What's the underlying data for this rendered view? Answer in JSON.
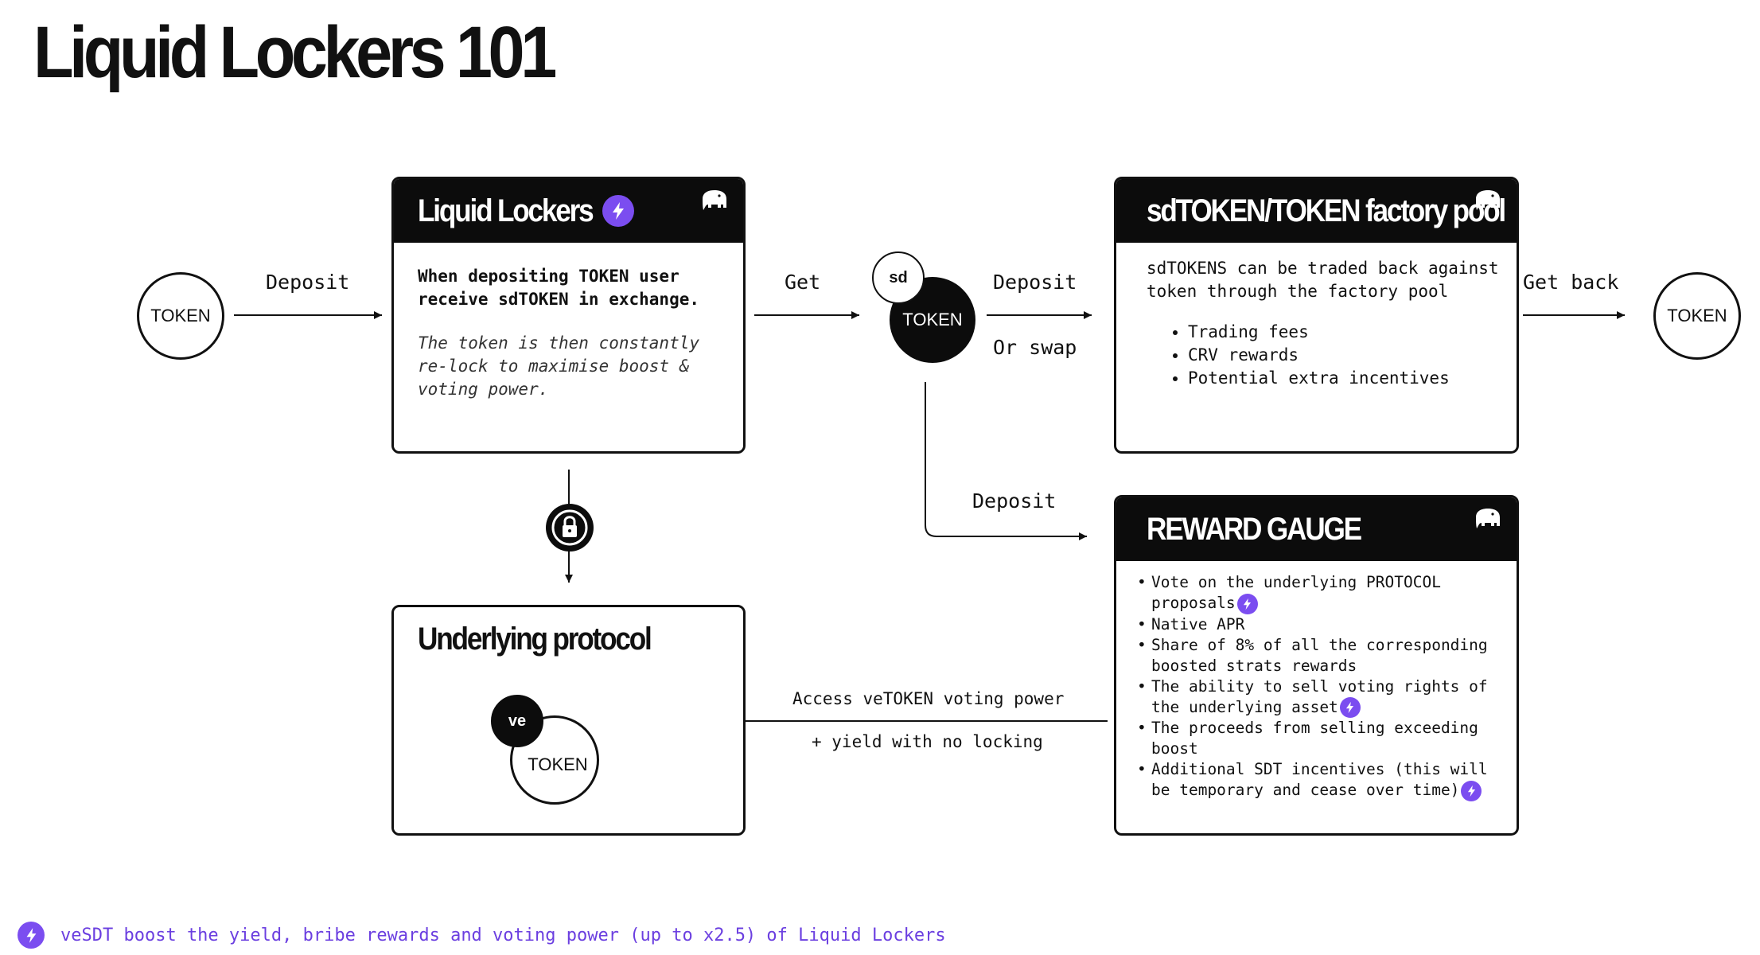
{
  "title": "Liquid Lockers 101",
  "colors": {
    "accent": "#7b4df0",
    "dark": "#0c0c0c",
    "line": "#111111"
  },
  "token_left": "TOKEN",
  "token_right": "TOKEN",
  "sdtoken": {
    "badge": "sd",
    "label": "TOKEN"
  },
  "vetoken": {
    "badge": "ve",
    "label": "TOKEN"
  },
  "edges": {
    "deposit_1": "Deposit",
    "get": "Get",
    "deposit_2": "Deposit",
    "or_swap": "Or swap",
    "get_back": "Get back",
    "deposit_3": "Deposit",
    "access_line1": "Access veTOKEN voting power",
    "access_line2": "+ yield with no locking"
  },
  "cards": {
    "liquid_lockers": {
      "title": "Liquid Lockers",
      "text": "When depositing TOKEN user\nreceive sdTOKEN in exchange.",
      "italic": "The token is then constantly\nre-lock to maximise boost &\nvoting power."
    },
    "factory_pool": {
      "title": "sdTOKEN/TOKEN factory pool",
      "text": "sdTOKENS can be traded back against\ntoken through the factory pool",
      "bullets": [
        "Trading fees",
        "CRV rewards",
        "Potential extra incentives"
      ]
    },
    "underlying": {
      "title": "Underlying protocol"
    },
    "reward_gauge": {
      "title": "REWARD GAUGE",
      "bullets": [
        "Vote on the underlying PROTOCOL proposals",
        "Native APR",
        "Share of 8% of all the corresponding boosted strats rewards",
        "The ability to sell voting rights of the underlying asset",
        "The proceeds from selling exceeding boost",
        "Additional SDT incentives (this will be temporary and cease over time)"
      ]
    }
  },
  "icons": [
    "lightning-bolt-icon",
    "elephant-icon",
    "lock-icon"
  ],
  "footnote": "veSDT boost the yield, bribe rewards and voting power (up to x2.5) of Liquid Lockers"
}
